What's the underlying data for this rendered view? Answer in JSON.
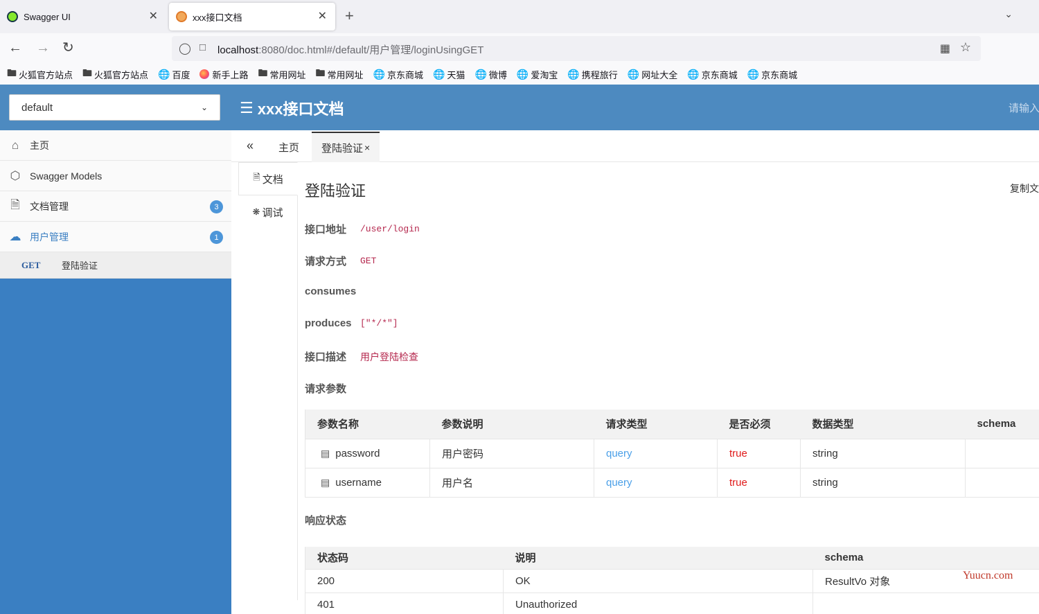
{
  "browser": {
    "tabs": [
      {
        "title": "Swagger UI"
      },
      {
        "title": "xxx接口文档"
      }
    ],
    "url_host": "localhost",
    "url_rest": ":8080/doc.html#/default/用户管理/loginUsingGET",
    "bookmarks": [
      "火狐官方站点",
      "火狐官方站点",
      "百度",
      "新手上路",
      "常用网址",
      "常用网址",
      "京东商城",
      "天猫",
      "微博",
      "爱淘宝",
      "携程旅行",
      "网址大全",
      "京东商城",
      "京东商城"
    ]
  },
  "header": {
    "group_selected": "default",
    "title": "xxx接口文档",
    "search_placeholder": "请输入"
  },
  "sidebar": {
    "items": [
      {
        "label": "主页",
        "icon": "home-icon"
      },
      {
        "label": "Swagger Models",
        "icon": "cube-icon"
      },
      {
        "label": "文档管理",
        "icon": "document-icon",
        "badge": "3"
      },
      {
        "label": "用户管理",
        "icon": "cloud-icon",
        "badge": "1"
      }
    ],
    "sub": {
      "method": "GET",
      "label": "登陆验证"
    }
  },
  "main_tabs": {
    "home": "主页",
    "active": "登陆验证",
    "close": "×"
  },
  "vtabs": {
    "doc": "文档",
    "debug": "调试"
  },
  "doc": {
    "title": "登陆验证",
    "copy": "复制文",
    "address_label": "接口地址",
    "address": "/user/login",
    "method_label": "请求方式",
    "method": "GET",
    "consumes_label": "consumes",
    "produces_label": "produces",
    "produces": "[\"*/*\"]",
    "desc_label": "接口描述",
    "desc": "用户登陆检查",
    "params_label": "请求参数",
    "resp_label": "响应状态"
  },
  "params_table": {
    "headers": [
      "参数名称",
      "参数说明",
      "请求类型",
      "是否必须",
      "数据类型",
      "schema"
    ],
    "rows": [
      [
        "password",
        "用户密码",
        "query",
        "true",
        "string",
        ""
      ],
      [
        "username",
        "用户名",
        "query",
        "true",
        "string",
        ""
      ]
    ]
  },
  "resp_table": {
    "headers": [
      "状态码",
      "说明",
      "schema"
    ],
    "rows": [
      [
        "200",
        "OK",
        "ResultVo 对象"
      ],
      [
        "401",
        "Unauthorized",
        ""
      ]
    ]
  },
  "watermark": "Yuucn.com",
  "colors": {
    "header_blue": "#4d8ac0",
    "sidebar_blue": "#3a7fc2",
    "accent_red": "#b5284e",
    "query_blue": "#4a9fe8"
  }
}
